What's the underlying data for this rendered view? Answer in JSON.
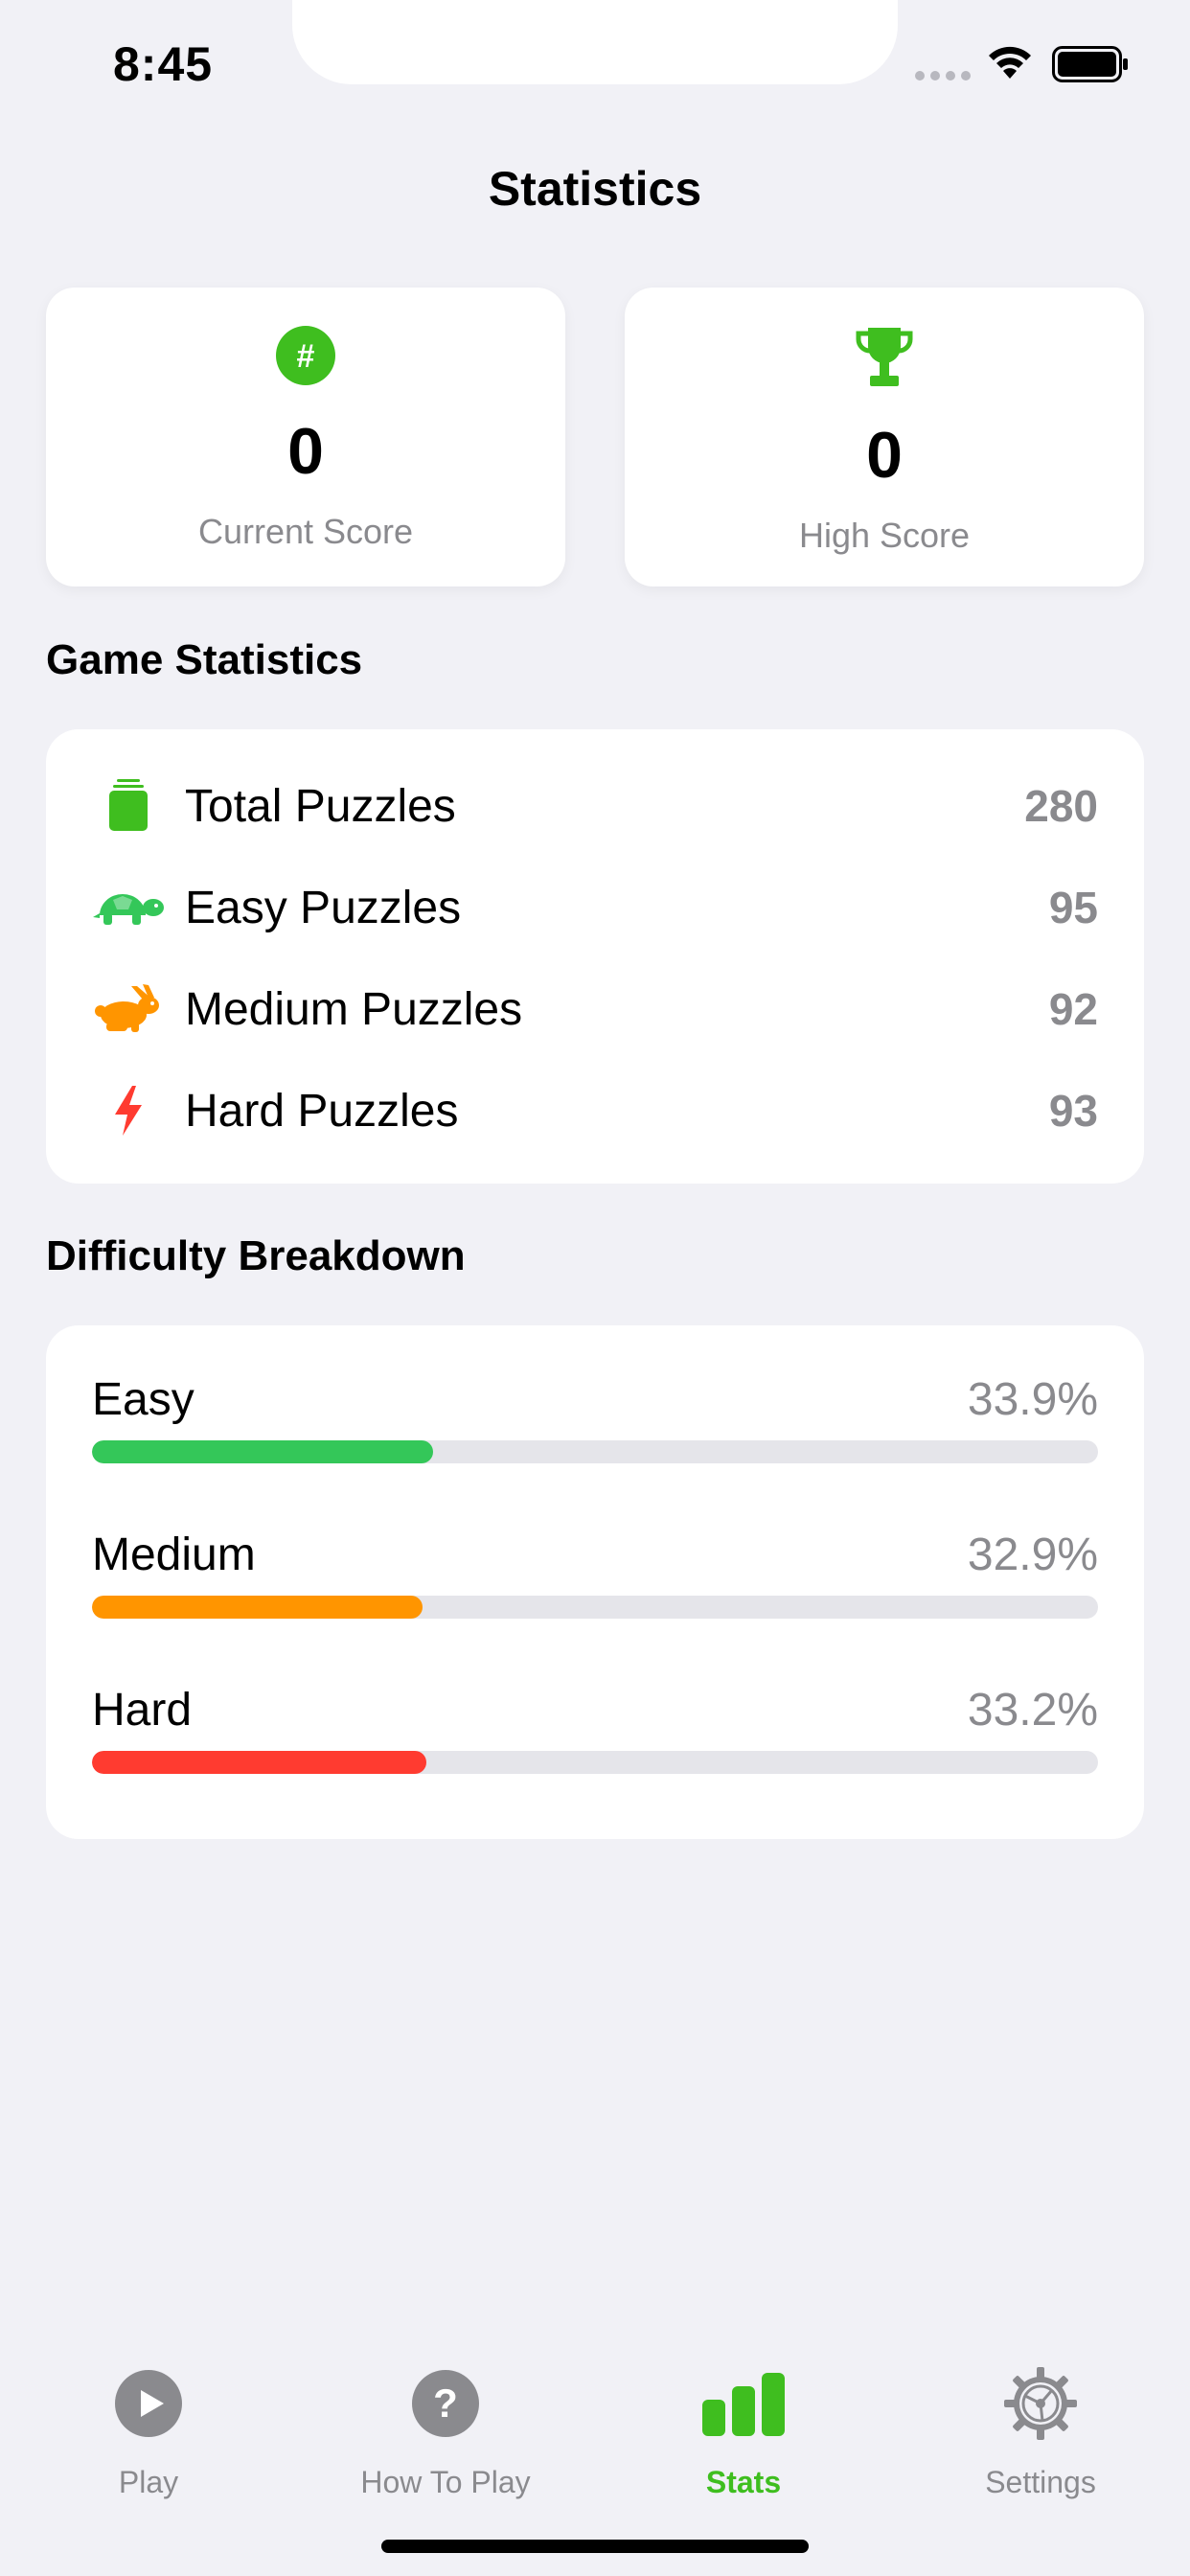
{
  "status_bar": {
    "time": "8:45"
  },
  "nav": {
    "title": "Statistics"
  },
  "scores": {
    "current": {
      "value": "0",
      "label": "Current Score",
      "icon": "number-badge-icon"
    },
    "high": {
      "value": "0",
      "label": "High Score",
      "icon": "trophy-icon"
    }
  },
  "game_statistics": {
    "title": "Game Statistics",
    "rows": [
      {
        "label": "Total Puzzles",
        "value": "280",
        "icon": "stack-icon",
        "color": "#3fbe1f"
      },
      {
        "label": "Easy Puzzles",
        "value": "95",
        "icon": "tortoise-icon",
        "color": "#34c759"
      },
      {
        "label": "Medium Puzzles",
        "value": "92",
        "icon": "hare-icon",
        "color": "#ff9500"
      },
      {
        "label": "Hard Puzzles",
        "value": "93",
        "icon": "bolt-icon",
        "color": "#ff3b30"
      }
    ]
  },
  "difficulty_breakdown": {
    "title": "Difficulty Breakdown",
    "rows": [
      {
        "label": "Easy",
        "percent_text": "33.9%",
        "fraction": 0.339,
        "color": "#34c759"
      },
      {
        "label": "Medium",
        "percent_text": "32.9%",
        "fraction": 0.329,
        "color": "#ff9500"
      },
      {
        "label": "Hard",
        "percent_text": "33.2%",
        "fraction": 0.332,
        "color": "#ff3b30"
      }
    ]
  },
  "tab_bar": {
    "active": "Stats",
    "tabs": [
      {
        "label": "Play",
        "icon": "play-circle-icon"
      },
      {
        "label": "How To Play",
        "icon": "question-circle-icon"
      },
      {
        "label": "Stats",
        "icon": "bar-chart-icon"
      },
      {
        "label": "Settings",
        "icon": "gear-icon"
      }
    ]
  },
  "colors": {
    "accent": "#3fbe1f",
    "background": "#f1f1f6",
    "secondary_text": "#8a8a8e"
  }
}
